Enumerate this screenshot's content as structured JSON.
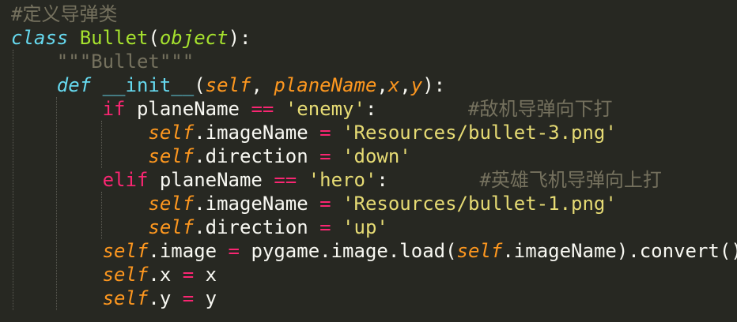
{
  "editor": {
    "language": "python",
    "background": "#272822",
    "colors": {
      "comment": "#75715e",
      "keyword": "#f92672",
      "storage": "#66d9ef",
      "class_name": "#a6e22e",
      "param": "#fd971f",
      "string": "#e6db74",
      "plain": "#f8f8f2"
    },
    "lines": [
      {
        "tokens": [
          {
            "text": "#定义导弹类",
            "type": "comment"
          }
        ]
      },
      {
        "tokens": [
          {
            "text": "class",
            "type": "storage-italic"
          },
          {
            "text": " ",
            "type": "plain"
          },
          {
            "text": "Bullet",
            "type": "class_name"
          },
          {
            "text": "(",
            "type": "plain"
          },
          {
            "text": "object",
            "type": "class_name-italic"
          },
          {
            "text": "):",
            "type": "plain"
          }
        ]
      },
      {
        "tokens": [
          {
            "text": "    ",
            "type": "plain"
          },
          {
            "text": "\"\"\"Bullet\"\"\"",
            "type": "comment"
          }
        ]
      },
      {
        "tokens": [
          {
            "text": "    ",
            "type": "plain"
          },
          {
            "text": "def",
            "type": "storage-italic"
          },
          {
            "text": " ",
            "type": "plain"
          },
          {
            "text": "__init__",
            "type": "storage"
          },
          {
            "text": "(",
            "type": "plain"
          },
          {
            "text": "self",
            "type": "param-italic"
          },
          {
            "text": ", ",
            "type": "plain"
          },
          {
            "text": "planeName",
            "type": "param-italic"
          },
          {
            "text": ",",
            "type": "plain"
          },
          {
            "text": "x",
            "type": "param-italic"
          },
          {
            "text": ",",
            "type": "plain"
          },
          {
            "text": "y",
            "type": "param-italic"
          },
          {
            "text": "):",
            "type": "plain"
          }
        ]
      },
      {
        "tokens": [
          {
            "text": "        ",
            "type": "plain"
          },
          {
            "text": "if",
            "type": "keyword"
          },
          {
            "text": " planeName ",
            "type": "plain"
          },
          {
            "text": "==",
            "type": "keyword"
          },
          {
            "text": " ",
            "type": "plain"
          },
          {
            "text": "'enemy'",
            "type": "string"
          },
          {
            "text": ":        ",
            "type": "plain"
          },
          {
            "text": "#敌机导弹向下打",
            "type": "comment"
          }
        ]
      },
      {
        "tokens": [
          {
            "text": "            ",
            "type": "plain"
          },
          {
            "text": "self",
            "type": "param-italic"
          },
          {
            "text": ".imageName ",
            "type": "plain"
          },
          {
            "text": "=",
            "type": "keyword"
          },
          {
            "text": " ",
            "type": "plain"
          },
          {
            "text": "'Resources/bullet-3.png'",
            "type": "string"
          }
        ]
      },
      {
        "tokens": [
          {
            "text": "            ",
            "type": "plain"
          },
          {
            "text": "self",
            "type": "param-italic"
          },
          {
            "text": ".direction ",
            "type": "plain"
          },
          {
            "text": "=",
            "type": "keyword"
          },
          {
            "text": " ",
            "type": "plain"
          },
          {
            "text": "'down'",
            "type": "string"
          }
        ]
      },
      {
        "tokens": [
          {
            "text": "        ",
            "type": "plain"
          },
          {
            "text": "elif",
            "type": "keyword"
          },
          {
            "text": " planeName ",
            "type": "plain"
          },
          {
            "text": "==",
            "type": "keyword"
          },
          {
            "text": " ",
            "type": "plain"
          },
          {
            "text": "'hero'",
            "type": "string"
          },
          {
            "text": ":        ",
            "type": "plain"
          },
          {
            "text": "#英雄飞机导弹向上打",
            "type": "comment"
          }
        ]
      },
      {
        "tokens": [
          {
            "text": "            ",
            "type": "plain"
          },
          {
            "text": "self",
            "type": "param-italic"
          },
          {
            "text": ".imageName ",
            "type": "plain"
          },
          {
            "text": "=",
            "type": "keyword"
          },
          {
            "text": " ",
            "type": "plain"
          },
          {
            "text": "'Resources/bullet-1.png'",
            "type": "string"
          }
        ]
      },
      {
        "tokens": [
          {
            "text": "            ",
            "type": "plain"
          },
          {
            "text": "self",
            "type": "param-italic"
          },
          {
            "text": ".direction ",
            "type": "plain"
          },
          {
            "text": "=",
            "type": "keyword"
          },
          {
            "text": " ",
            "type": "plain"
          },
          {
            "text": "'up'",
            "type": "string"
          }
        ]
      },
      {
        "tokens": [
          {
            "text": "        ",
            "type": "plain"
          },
          {
            "text": "self",
            "type": "param-italic"
          },
          {
            "text": ".image ",
            "type": "plain"
          },
          {
            "text": "=",
            "type": "keyword"
          },
          {
            "text": " pygame.image.load(",
            "type": "plain"
          },
          {
            "text": "self",
            "type": "param-italic"
          },
          {
            "text": ".imageName).convert()",
            "type": "plain"
          }
        ]
      },
      {
        "tokens": [
          {
            "text": "        ",
            "type": "plain"
          },
          {
            "text": "self",
            "type": "param-italic"
          },
          {
            "text": ".x ",
            "type": "plain"
          },
          {
            "text": "=",
            "type": "keyword"
          },
          {
            "text": " x",
            "type": "plain"
          }
        ]
      },
      {
        "tokens": [
          {
            "text": "        ",
            "type": "plain"
          },
          {
            "text": "self",
            "type": "param-italic"
          },
          {
            "text": ".y ",
            "type": "plain"
          },
          {
            "text": "=",
            "type": "keyword"
          },
          {
            "text": " y",
            "type": "plain"
          }
        ]
      }
    ]
  }
}
